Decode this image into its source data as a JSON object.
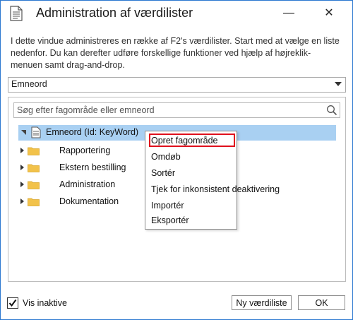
{
  "window": {
    "title": "Administration af værdilister",
    "minimize_symbol": "—",
    "close_symbol": "✕"
  },
  "intro_text": "I dette vindue administreres en række af F2's værdilister. Start med at vælge en liste nedenfor. Du kan derefter udføre forskellige funktioner ved hjælp af højreklik-menuen samt drag-and-drop.",
  "list_selector": {
    "value": "Emneord"
  },
  "search": {
    "placeholder": "Søg efter fagområde eller emneord",
    "value": ""
  },
  "tree": {
    "root": {
      "label": "Emneord (Id: KeyWord)",
      "icon": "document-icon",
      "expanded": true,
      "selected": true
    },
    "children": [
      {
        "label": "Rapportering",
        "icon": "folder-icon"
      },
      {
        "label": "Ekstern bestilling",
        "icon": "folder-icon"
      },
      {
        "label": "Administration",
        "icon": "folder-icon"
      },
      {
        "label": "Dokumentation",
        "icon": "folder-icon"
      }
    ]
  },
  "context_menu": {
    "items": [
      {
        "label": "Opret fagområde",
        "highlighted": true
      },
      {
        "label": "Omdøb"
      },
      {
        "label": "Sortér"
      },
      {
        "label": "Tjek for inkonsistent deaktivering"
      },
      {
        "label": "Importér"
      },
      {
        "label": "Eksportér"
      }
    ]
  },
  "footer": {
    "show_inactive": {
      "label": "Vis inaktive",
      "checked": true
    },
    "new_list_button": "Ny værdiliste",
    "ok_button": "OK"
  },
  "colors": {
    "window_border": "#2b78d0",
    "selection": "#a9d0f2",
    "highlight_box": "#e0101c",
    "folder": "#f2c24a"
  }
}
